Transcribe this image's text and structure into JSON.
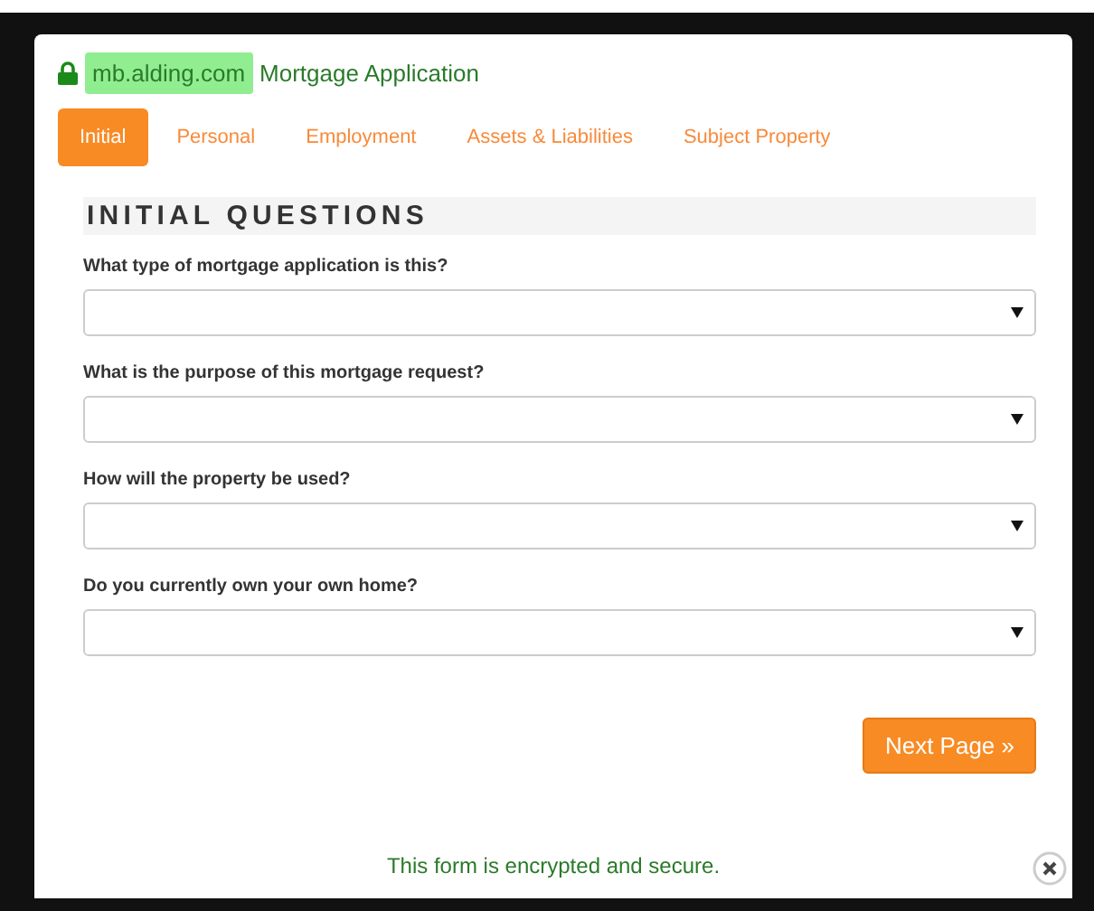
{
  "header": {
    "domain": "mb.alding.com",
    "title": "Mortgage Application"
  },
  "tabs": [
    {
      "label": "Initial",
      "selected": true
    },
    {
      "label": "Personal",
      "selected": false
    },
    {
      "label": "Employment",
      "selected": false
    },
    {
      "label": "Assets & Liabilities",
      "selected": false
    },
    {
      "label": "Subject Property",
      "selected": false
    }
  ],
  "section_title": "INITIAL QUESTIONS",
  "questions": [
    {
      "label": "What type of mortgage application is this?"
    },
    {
      "label": "What is the purpose of this mortgage request?"
    },
    {
      "label": "How will the property be used?"
    },
    {
      "label": "Do you currently own your own home?"
    }
  ],
  "next_button": "Next Page »",
  "footer": "This form is encrypted and secure."
}
